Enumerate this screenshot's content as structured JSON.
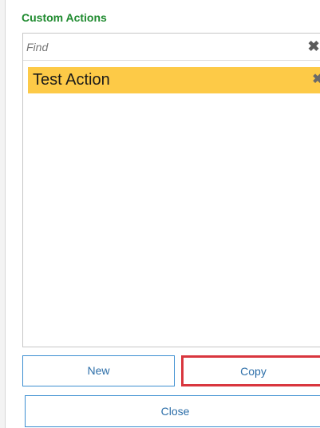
{
  "panel": {
    "title": "Custom Actions",
    "title_color": "#1e8a2e"
  },
  "search": {
    "placeholder": "Find",
    "value": "",
    "clear_icon": "close-icon"
  },
  "actions": {
    "items": [
      {
        "label": "Test Action",
        "selected": true,
        "highlight_color": "#fdca47",
        "remove_icon": "close-icon"
      }
    ]
  },
  "buttons": {
    "new_label": "New",
    "copy_label": "Copy",
    "close_label": "Close",
    "accent_color": "#3d8fd1",
    "focus_color": "#d9363e"
  }
}
